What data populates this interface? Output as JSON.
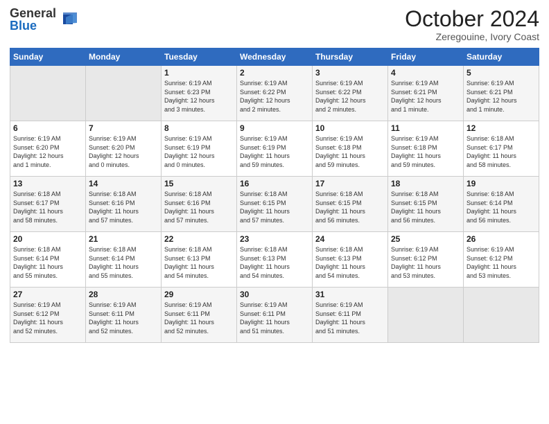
{
  "logo": {
    "general": "General",
    "blue": "Blue"
  },
  "title": "October 2024",
  "location": "Zeregouine, Ivory Coast",
  "days_of_week": [
    "Sunday",
    "Monday",
    "Tuesday",
    "Wednesday",
    "Thursday",
    "Friday",
    "Saturday"
  ],
  "weeks": [
    [
      {
        "day": "",
        "info": ""
      },
      {
        "day": "",
        "info": ""
      },
      {
        "day": "1",
        "info": "Sunrise: 6:19 AM\nSunset: 6:23 PM\nDaylight: 12 hours\nand 3 minutes."
      },
      {
        "day": "2",
        "info": "Sunrise: 6:19 AM\nSunset: 6:22 PM\nDaylight: 12 hours\nand 2 minutes."
      },
      {
        "day": "3",
        "info": "Sunrise: 6:19 AM\nSunset: 6:22 PM\nDaylight: 12 hours\nand 2 minutes."
      },
      {
        "day": "4",
        "info": "Sunrise: 6:19 AM\nSunset: 6:21 PM\nDaylight: 12 hours\nand 1 minute."
      },
      {
        "day": "5",
        "info": "Sunrise: 6:19 AM\nSunset: 6:21 PM\nDaylight: 12 hours\nand 1 minute."
      }
    ],
    [
      {
        "day": "6",
        "info": "Sunrise: 6:19 AM\nSunset: 6:20 PM\nDaylight: 12 hours\nand 1 minute."
      },
      {
        "day": "7",
        "info": "Sunrise: 6:19 AM\nSunset: 6:20 PM\nDaylight: 12 hours\nand 0 minutes."
      },
      {
        "day": "8",
        "info": "Sunrise: 6:19 AM\nSunset: 6:19 PM\nDaylight: 12 hours\nand 0 minutes."
      },
      {
        "day": "9",
        "info": "Sunrise: 6:19 AM\nSunset: 6:19 PM\nDaylight: 11 hours\nand 59 minutes."
      },
      {
        "day": "10",
        "info": "Sunrise: 6:19 AM\nSunset: 6:18 PM\nDaylight: 11 hours\nand 59 minutes."
      },
      {
        "day": "11",
        "info": "Sunrise: 6:19 AM\nSunset: 6:18 PM\nDaylight: 11 hours\nand 59 minutes."
      },
      {
        "day": "12",
        "info": "Sunrise: 6:18 AM\nSunset: 6:17 PM\nDaylight: 11 hours\nand 58 minutes."
      }
    ],
    [
      {
        "day": "13",
        "info": "Sunrise: 6:18 AM\nSunset: 6:17 PM\nDaylight: 11 hours\nand 58 minutes."
      },
      {
        "day": "14",
        "info": "Sunrise: 6:18 AM\nSunset: 6:16 PM\nDaylight: 11 hours\nand 57 minutes."
      },
      {
        "day": "15",
        "info": "Sunrise: 6:18 AM\nSunset: 6:16 PM\nDaylight: 11 hours\nand 57 minutes."
      },
      {
        "day": "16",
        "info": "Sunrise: 6:18 AM\nSunset: 6:15 PM\nDaylight: 11 hours\nand 57 minutes."
      },
      {
        "day": "17",
        "info": "Sunrise: 6:18 AM\nSunset: 6:15 PM\nDaylight: 11 hours\nand 56 minutes."
      },
      {
        "day": "18",
        "info": "Sunrise: 6:18 AM\nSunset: 6:15 PM\nDaylight: 11 hours\nand 56 minutes."
      },
      {
        "day": "19",
        "info": "Sunrise: 6:18 AM\nSunset: 6:14 PM\nDaylight: 11 hours\nand 56 minutes."
      }
    ],
    [
      {
        "day": "20",
        "info": "Sunrise: 6:18 AM\nSunset: 6:14 PM\nDaylight: 11 hours\nand 55 minutes."
      },
      {
        "day": "21",
        "info": "Sunrise: 6:18 AM\nSunset: 6:14 PM\nDaylight: 11 hours\nand 55 minutes."
      },
      {
        "day": "22",
        "info": "Sunrise: 6:18 AM\nSunset: 6:13 PM\nDaylight: 11 hours\nand 54 minutes."
      },
      {
        "day": "23",
        "info": "Sunrise: 6:18 AM\nSunset: 6:13 PM\nDaylight: 11 hours\nand 54 minutes."
      },
      {
        "day": "24",
        "info": "Sunrise: 6:18 AM\nSunset: 6:13 PM\nDaylight: 11 hours\nand 54 minutes."
      },
      {
        "day": "25",
        "info": "Sunrise: 6:19 AM\nSunset: 6:12 PM\nDaylight: 11 hours\nand 53 minutes."
      },
      {
        "day": "26",
        "info": "Sunrise: 6:19 AM\nSunset: 6:12 PM\nDaylight: 11 hours\nand 53 minutes."
      }
    ],
    [
      {
        "day": "27",
        "info": "Sunrise: 6:19 AM\nSunset: 6:12 PM\nDaylight: 11 hours\nand 52 minutes."
      },
      {
        "day": "28",
        "info": "Sunrise: 6:19 AM\nSunset: 6:11 PM\nDaylight: 11 hours\nand 52 minutes."
      },
      {
        "day": "29",
        "info": "Sunrise: 6:19 AM\nSunset: 6:11 PM\nDaylight: 11 hours\nand 52 minutes."
      },
      {
        "day": "30",
        "info": "Sunrise: 6:19 AM\nSunset: 6:11 PM\nDaylight: 11 hours\nand 51 minutes."
      },
      {
        "day": "31",
        "info": "Sunrise: 6:19 AM\nSunset: 6:11 PM\nDaylight: 11 hours\nand 51 minutes."
      },
      {
        "day": "",
        "info": ""
      },
      {
        "day": "",
        "info": ""
      }
    ]
  ]
}
